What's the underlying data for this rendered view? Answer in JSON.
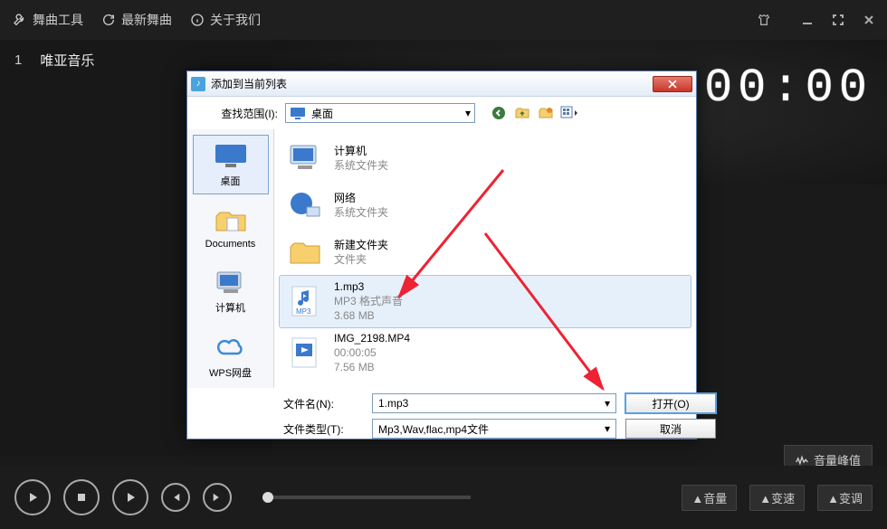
{
  "topbar": {
    "tools": "舞曲工具",
    "latest": "最新舞曲",
    "about": "关于我们"
  },
  "playlist": {
    "items": [
      {
        "index": "1",
        "title": "唯亚音乐"
      }
    ]
  },
  "timer": "00:00",
  "volume_peak": "音量峰值",
  "bottom": {
    "vol": "▲音量",
    "speed": "▲变速",
    "pitch": "▲变调"
  },
  "dialog": {
    "title": "添加到当前列表",
    "look_in_label": "查找范围(I):",
    "look_in_value": "桌面",
    "places": {
      "desktop": "桌面",
      "documents": "Documents",
      "computer": "计算机",
      "wps": "WPS网盘"
    },
    "files": [
      {
        "name": "计算机",
        "sub1": "系统文件夹",
        "sub2": ""
      },
      {
        "name": "网络",
        "sub1": "系统文件夹",
        "sub2": ""
      },
      {
        "name": "新建文件夹",
        "sub1": "文件夹",
        "sub2": ""
      },
      {
        "name": "1.mp3",
        "sub1": "MP3 格式声音",
        "sub2": "3.68 MB"
      },
      {
        "name": "IMG_2198.MP4",
        "sub1": "00:00:05",
        "sub2": "7.56 MB"
      }
    ],
    "filename_label": "文件名(N):",
    "filename_value": "1.mp3",
    "filetype_label": "文件类型(T):",
    "filetype_value": "Mp3,Wav,flac,mp4文件",
    "open_btn": "打开(O)",
    "cancel_btn": "取消"
  }
}
